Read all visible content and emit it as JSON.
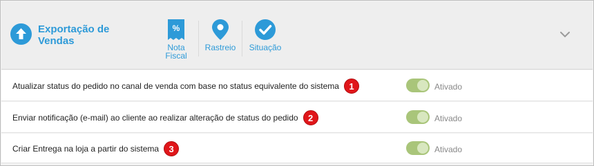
{
  "header": {
    "title": "Exportação de Vendas",
    "nav": [
      {
        "label": "Nota Fiscal",
        "icon": "receipt-percent-icon"
      },
      {
        "label": "Rastreio",
        "icon": "location-pin-icon"
      },
      {
        "label": "Situação",
        "icon": "check-circle-icon"
      }
    ],
    "collapse_icon": "chevron-down-icon"
  },
  "colors": {
    "accent": "#2d9ad8",
    "badge": "#e0161a",
    "toggle_on": "#a9c57a"
  },
  "settings": [
    {
      "label": "Atualizar status do pedido no canal de venda com base no status equivalente do sistema",
      "badge": "1",
      "status": "Ativado"
    },
    {
      "label": "Enviar notificação (e-mail) ao cliente ao realizar alteração de status do pedido",
      "badge": "2",
      "status": "Ativado"
    },
    {
      "label": "Criar Entrega na loja a partir do sistema",
      "badge": "3",
      "status": "Ativado"
    }
  ]
}
